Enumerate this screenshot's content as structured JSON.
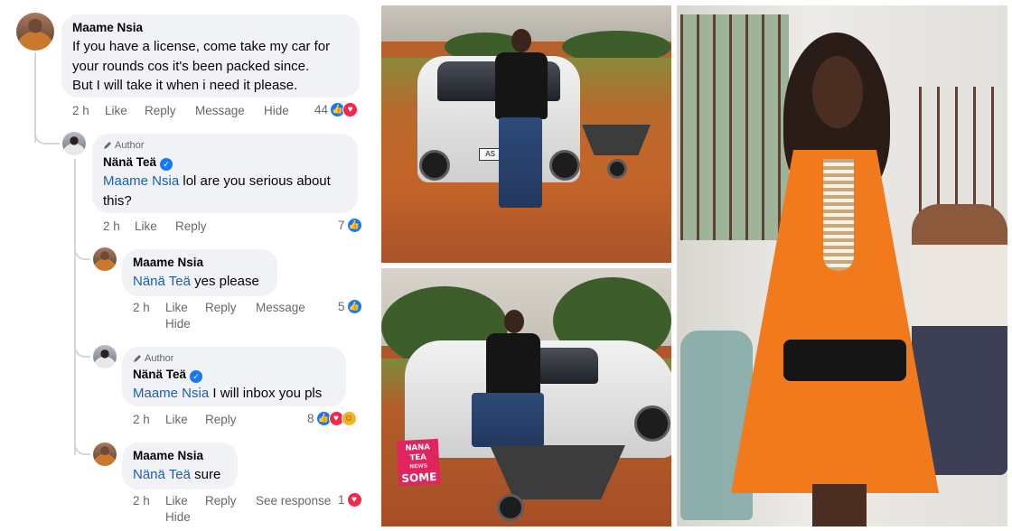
{
  "comments": [
    {
      "name": "Maame Nsia",
      "text_lines": [
        "If you have a license, come take my car for",
        "your rounds cos it's been packed since.",
        "But I will take it when i need it please."
      ],
      "time": "2 h",
      "like": "Like",
      "reply": "Reply",
      "message": "Message",
      "hide": "Hide",
      "reaction_count": "44"
    },
    {
      "author_badge": "Author",
      "name": "Nänä Teä",
      "mention": "Maame Nsia",
      "text_lines": [
        " lol are you serious about",
        "this?"
      ],
      "time": "2 h",
      "like": "Like",
      "reply": "Reply",
      "reaction_count": "7"
    },
    {
      "name": "Maame Nsia",
      "mention": "Nänä Teä",
      "text": " yes please",
      "time": "2 h",
      "like": "Like",
      "reply": "Reply",
      "message": "Message",
      "hide": "Hide",
      "reaction_count": "5"
    },
    {
      "author_badge": "Author",
      "name": "Nänä Teä",
      "mention": "Maame Nsia",
      "text": " I will inbox you pls",
      "time": "2 h",
      "like": "Like",
      "reply": "Reply",
      "reaction_count": "8"
    },
    {
      "name": "Maame Nsia",
      "mention": "Nänä Teä",
      "text": " sure",
      "time": "2 h",
      "like": "Like",
      "reply": "Reply",
      "see_response": "See response",
      "hide": "Hide",
      "reaction_count": "1"
    }
  ],
  "photos": {
    "plate_text": "AS 5",
    "watermark": {
      "line1": "NANA TEA",
      "line2": "NEWS",
      "line3": "SOME"
    }
  },
  "colors": {
    "mention": "#1b5fb5",
    "like": "#1877f2",
    "love": "#f02849",
    "bubble": "#f0f2f5",
    "meta": "#65676b"
  }
}
